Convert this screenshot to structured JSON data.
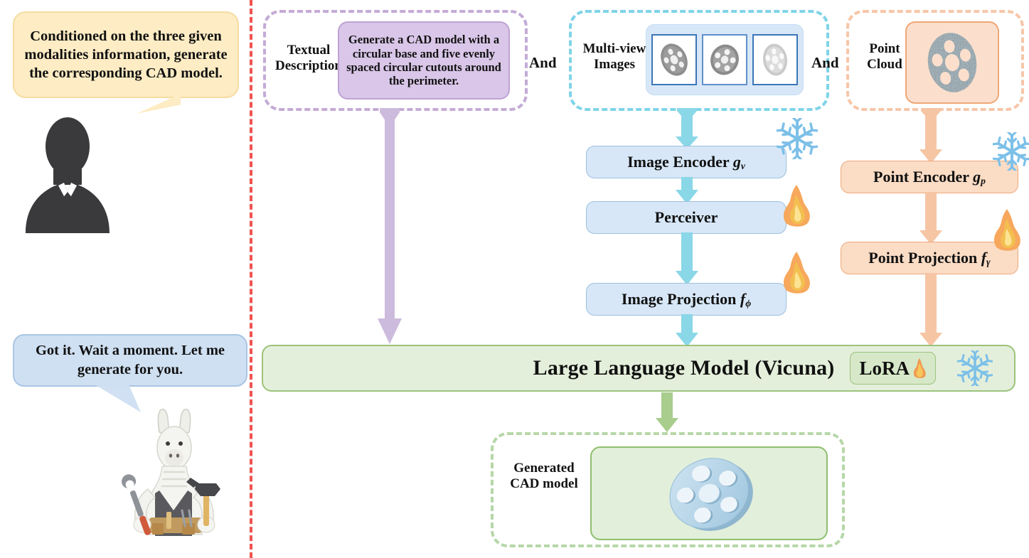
{
  "user": {
    "bubble_text": "Conditioned on the three given modalities information, generate the corresponding CAD model.",
    "icon": "person-silhouette-icon"
  },
  "assistant": {
    "bubble_text": "Got it. Wait a moment. Let me generate for you.",
    "icon": "llama-with-tools-icon"
  },
  "modalities": {
    "text": {
      "label": "Textual\nDescription",
      "label_line1": "Textual",
      "label_line2": "Description",
      "prompt": "Generate a CAD model with a circular base and five evenly spaced circular cutouts around the perimeter.",
      "accent": "#c4abd6",
      "card_fill": "#d9c6e8"
    },
    "images": {
      "label_line1": "Multi-view",
      "label_line2": "Images",
      "thumbnail_count": 3,
      "thumbnail_alt": "flanged-wheel-render",
      "accent": "#7fd4e8",
      "card_fill": "#d8e7f8"
    },
    "pointcloud": {
      "label_line1": "Point",
      "label_line2": "Cloud",
      "alt": "point-cloud-wheel",
      "accent": "#f7c6a8",
      "card_fill": "#fbdfcc"
    }
  },
  "connectors": {
    "and_1": "And",
    "and_2": "And"
  },
  "pipeline": {
    "image_branch": [
      {
        "name": "Image Encoder",
        "symbol": "g",
        "symbol_sub": "v",
        "state": "frozen"
      },
      {
        "name": "Perceiver",
        "symbol": "",
        "symbol_sub": "",
        "state": "trainable"
      },
      {
        "name": "Image Projection",
        "symbol": "f",
        "symbol_sub": "ϕ",
        "state": "trainable"
      }
    ],
    "point_branch": [
      {
        "name": "Point Encoder",
        "symbol": "g",
        "symbol_sub": "p",
        "state": "frozen"
      },
      {
        "name": "Point Projection",
        "symbol": "f",
        "symbol_sub": "γ",
        "state": "trainable"
      }
    ]
  },
  "llm": {
    "title": "Large Language Model (Vicuna)",
    "lora_label": "LoRA",
    "lora_state": "trainable",
    "backbone_state": "frozen",
    "fill": "#e4efdb",
    "border": "#9cc37c"
  },
  "output": {
    "label_line1": "Generated",
    "label_line2": "CAD model",
    "alt": "generated-cad-wheel",
    "accent": "#b6d7a8"
  },
  "legend": {
    "frozen_icon": "snowflake-icon",
    "trainable_icon": "fire-icon"
  },
  "colors": {
    "divider": "#ef5350",
    "text_accent": "#c4abd6",
    "image_accent": "#7fd4e8",
    "point_accent": "#f7c6a8",
    "output_accent": "#b6d7a8",
    "user_bubble": "#fdecc4",
    "assistant_bubble": "#cfe0f2"
  }
}
